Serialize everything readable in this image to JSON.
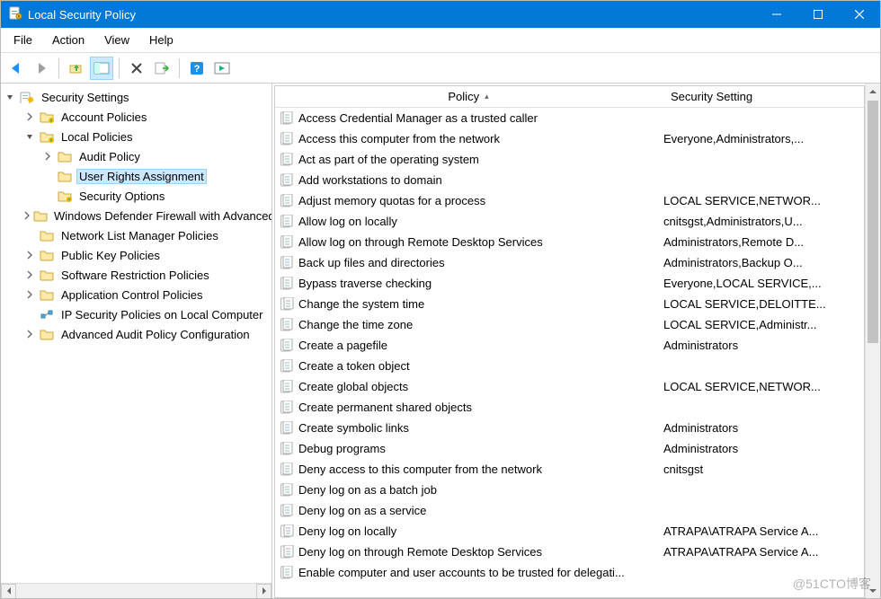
{
  "window": {
    "title": "Local Security Policy"
  },
  "menubar": [
    "File",
    "Action",
    "View",
    "Help"
  ],
  "tree": {
    "root": "Security Settings",
    "nodes": [
      {
        "label": "Account Policies",
        "chevron": "right",
        "indent": 1,
        "icon": "folder",
        "overlay": "lock"
      },
      {
        "label": "Local Policies",
        "chevron": "down",
        "indent": 1,
        "icon": "folder",
        "overlay": "lock"
      },
      {
        "label": "Audit Policy",
        "chevron": "right",
        "indent": 2,
        "icon": "folder"
      },
      {
        "label": "User Rights Assignment",
        "chevron": "none",
        "indent": 2,
        "icon": "folder",
        "selected": true
      },
      {
        "label": "Security Options",
        "chevron": "none",
        "indent": 2,
        "icon": "folder",
        "overlay": "lock"
      },
      {
        "label": "Windows Defender Firewall with Advanced Security",
        "chevron": "right",
        "indent": 1,
        "icon": "folder"
      },
      {
        "label": "Network List Manager Policies",
        "chevron": "none",
        "indent": 1,
        "icon": "folder"
      },
      {
        "label": "Public Key Policies",
        "chevron": "right",
        "indent": 1,
        "icon": "folder"
      },
      {
        "label": "Software Restriction Policies",
        "chevron": "right",
        "indent": 1,
        "icon": "folder"
      },
      {
        "label": "Application Control Policies",
        "chevron": "right",
        "indent": 1,
        "icon": "folder"
      },
      {
        "label": "IP Security Policies on Local Computer",
        "chevron": "none",
        "indent": 1,
        "icon": "ipsec"
      },
      {
        "label": "Advanced Audit Policy Configuration",
        "chevron": "right",
        "indent": 1,
        "icon": "folder"
      }
    ]
  },
  "list": {
    "columns": [
      "Policy",
      "Security Setting"
    ],
    "rows": [
      {
        "p": "Access Credential Manager as a trusted caller",
        "s": "",
        "i": "doc2"
      },
      {
        "p": "Access this computer from the network",
        "s": "Everyone,Administrators,...",
        "i": "doc2"
      },
      {
        "p": "Act as part of the operating system",
        "s": "",
        "i": "doc2"
      },
      {
        "p": "Add workstations to domain",
        "s": "",
        "i": "doc2"
      },
      {
        "p": "Adjust memory quotas for a process",
        "s": "LOCAL SERVICE,NETWOR...",
        "i": "doc2"
      },
      {
        "p": "Allow log on locally",
        "s": "cnitsgst,Administrators,U...",
        "i": "doc2"
      },
      {
        "p": "Allow log on through Remote Desktop Services",
        "s": "Administrators,Remote D...",
        "i": "doc2"
      },
      {
        "p": "Back up files and directories",
        "s": "Administrators,Backup O...",
        "i": "doc2"
      },
      {
        "p": "Bypass traverse checking",
        "s": "Everyone,LOCAL SERVICE,...",
        "i": "doc2"
      },
      {
        "p": "Change the system time",
        "s": "LOCAL SERVICE,DELOITTE...",
        "i": "doc3"
      },
      {
        "p": "Change the time zone",
        "s": "LOCAL SERVICE,Administr...",
        "i": "doc2"
      },
      {
        "p": "Create a pagefile",
        "s": "Administrators",
        "i": "doc2"
      },
      {
        "p": "Create a token object",
        "s": "",
        "i": "doc2"
      },
      {
        "p": "Create global objects",
        "s": "LOCAL SERVICE,NETWOR...",
        "i": "doc2"
      },
      {
        "p": "Create permanent shared objects",
        "s": "",
        "i": "doc2"
      },
      {
        "p": "Create symbolic links",
        "s": "Administrators",
        "i": "doc2"
      },
      {
        "p": "Debug programs",
        "s": "Administrators",
        "i": "doc2"
      },
      {
        "p": "Deny access to this computer from the network",
        "s": "cnitsgst",
        "i": "doc2"
      },
      {
        "p": "Deny log on as a batch job",
        "s": "",
        "i": "doc2"
      },
      {
        "p": "Deny log on as a service",
        "s": "",
        "i": "doc2"
      },
      {
        "p": "Deny log on locally",
        "s": "ATRAPA\\ATRAPA Service A...",
        "i": "doc3"
      },
      {
        "p": "Deny log on through Remote Desktop Services",
        "s": "ATRAPA\\ATRAPA Service A...",
        "i": "doc3"
      },
      {
        "p": "Enable computer and user accounts to be trusted for delegati...",
        "s": "",
        "i": "doc2"
      }
    ]
  },
  "watermark": "@51CTO博客"
}
